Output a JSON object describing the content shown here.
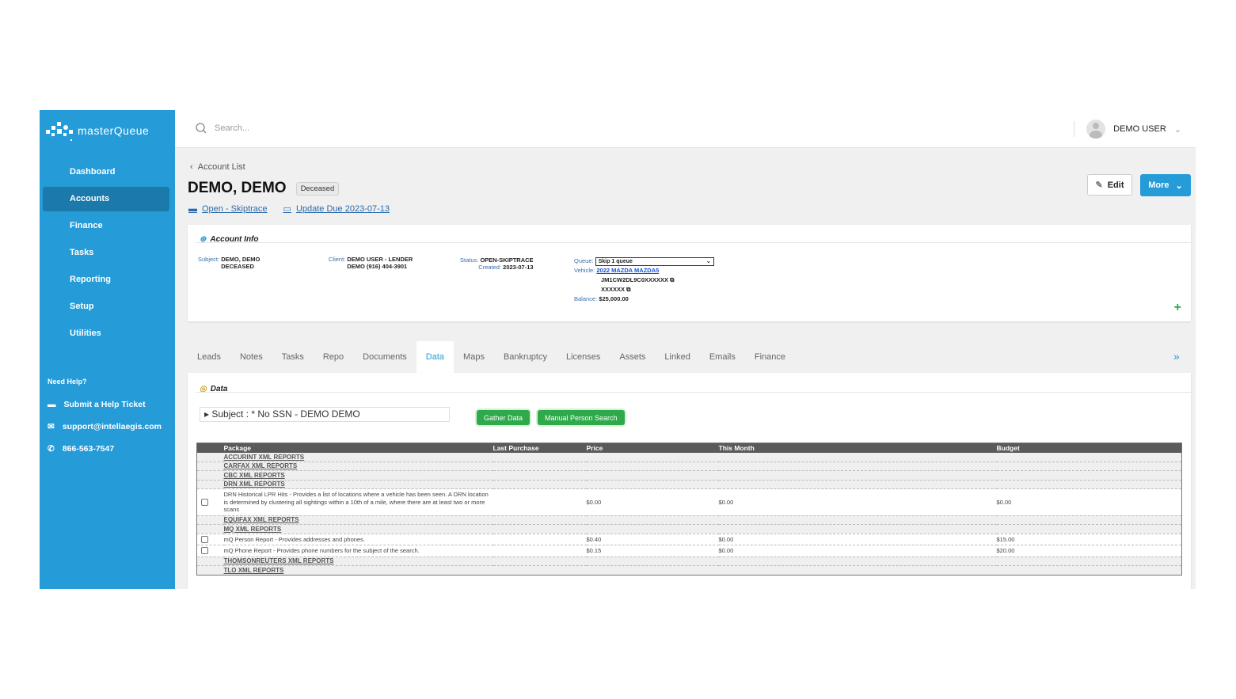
{
  "app": {
    "logo_text": "masterQueue"
  },
  "sidebar": {
    "items": [
      {
        "label": "Dashboard"
      },
      {
        "label": "Accounts",
        "active": true
      },
      {
        "label": "Finance"
      },
      {
        "label": "Tasks"
      },
      {
        "label": "Reporting"
      },
      {
        "label": "Setup"
      },
      {
        "label": "Utilities"
      }
    ],
    "help_title": "Need Help?",
    "help_links": [
      {
        "icon": "ticket-icon",
        "label": "Submit a Help Ticket"
      },
      {
        "icon": "mail-icon",
        "label": "support@intellaegis.com"
      },
      {
        "icon": "phone-icon",
        "label": "866-563-7547"
      }
    ]
  },
  "topbar": {
    "search_placeholder": "Search...",
    "user_name": "DEMO USER"
  },
  "page": {
    "breadcrumb": "Account List",
    "title": "DEMO, DEMO",
    "badge": "Deceased",
    "status_link": "Open - Skiptrace",
    "due_link": "Update Due 2023-07-13",
    "edit_label": "Edit",
    "more_label": "More"
  },
  "account_info": {
    "heading": "Account Info",
    "subject_label": "Subject:",
    "subject_name": "DEMO, DEMO",
    "subject_status": "DECEASED",
    "client_label": "Client:",
    "client_name": "DEMO USER - LENDER",
    "client_phone": "DEMO (916) 404-3901",
    "status_label": "Status:",
    "status": "OPEN-SKIPTRACE",
    "created_label": "Created:",
    "created": "2023-07-13",
    "queue_label": "Queue:",
    "queue": "Skip 1 queue",
    "vehicle_label": "Vehicle:",
    "vehicle": "2022 MAZDA MAZDA5",
    "vin": "JM1CW2DL9C0XXXXXX",
    "plate": "XXXXXX",
    "balance_label": "Balance:",
    "balance": "$25,000.00"
  },
  "tabs": [
    {
      "label": "Leads"
    },
    {
      "label": "Notes"
    },
    {
      "label": "Tasks"
    },
    {
      "label": "Repo"
    },
    {
      "label": "Documents"
    },
    {
      "label": "Data",
      "active": true
    },
    {
      "label": "Maps"
    },
    {
      "label": "Bankruptcy"
    },
    {
      "label": "Licenses"
    },
    {
      "label": "Assets"
    },
    {
      "label": "Linked"
    },
    {
      "label": "Emails"
    },
    {
      "label": "Finance"
    }
  ],
  "data_section": {
    "heading": "Data",
    "subject_select": "Subject : * No SSN - DEMO DEMO",
    "gather_label": "Gather Data",
    "manual_label": "Manual Person Search",
    "columns": [
      "Package",
      "Last Purchase",
      "Price",
      "This Month",
      "Budget"
    ],
    "rows": [
      {
        "group": "ACCURINT XML REPORTS"
      },
      {
        "group": "CARFAX XML REPORTS"
      },
      {
        "group": "CBC XML REPORTS"
      },
      {
        "group": "DRN XML REPORTS"
      },
      {
        "package": "DRN Historical LPR Hits - Provides a list of locations where a vehicle has been seen. A DRN location is determined by clustering all sightings within a 10th of a mile, where there are at least two or more scans",
        "last": "",
        "price": "$0.00",
        "month": "$0.00",
        "budget": "$0.00"
      },
      {
        "group": "EQUIFAX XML REPORTS"
      },
      {
        "group": "MQ XML REPORTS"
      },
      {
        "package": "mQ Person Report - Provides addresses and phones.",
        "last": "",
        "price": "$0.40",
        "month": "$0.00",
        "budget": "$15.00"
      },
      {
        "package": "mQ Phone Report - Provides phone numbers for the subject of the search.",
        "last": "",
        "price": "$0.15",
        "month": "$0.00",
        "budget": "$20.00"
      },
      {
        "group": "THOMSONREUTERS XML REPORTS"
      },
      {
        "group": "TLO XML REPORTS"
      }
    ]
  }
}
